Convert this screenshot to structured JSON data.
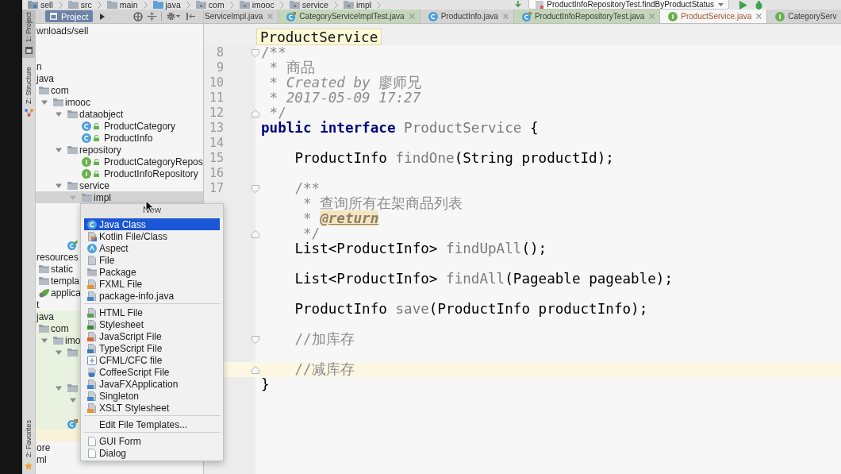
{
  "nav_bar": {
    "crumbs": [
      {
        "label": "sell",
        "kind": "module"
      },
      {
        "label": "src",
        "kind": "folder"
      },
      {
        "label": "main",
        "kind": "folder"
      },
      {
        "label": "java",
        "kind": "source"
      },
      {
        "label": "com",
        "kind": "package"
      },
      {
        "label": "imooc",
        "kind": "package"
      },
      {
        "label": "service",
        "kind": "package"
      },
      {
        "label": "impl",
        "kind": "package"
      }
    ],
    "run_config": "ProductInfoRepositoryTest.findByProductStatus"
  },
  "tool_strip": {
    "top": [
      {
        "label": "1: Project",
        "kind": "project",
        "selected": true
      },
      {
        "label": "Z: Structure",
        "kind": "structure",
        "selected": false
      }
    ],
    "bottom": [
      {
        "label": "2: Favorites",
        "kind": "favorites",
        "selected": false
      }
    ]
  },
  "project_panel": {
    "title": "Project",
    "nodes": [
      {
        "label": "wnloads/sell",
        "selected": false,
        "children": [
          {
            "selected": false
          },
          {
            "selected": false,
            "children": [
              {
                "label": "n",
                "selected": false,
                "children": [
                  {
                    "label": "java",
                    "selected": false,
                    "children": [
                      {
                        "label": "com",
                        "kind": "folder",
                        "selected": false,
                        "children": [
                          {
                            "label": "imooc",
                            "kind": "folder",
                            "expanded": true,
                            "selected": false,
                            "children": [
                              {
                                "label": "dataobject",
                                "kind": "folder",
                                "expanded": true,
                                "selected": false,
                                "children": [
                                  {
                                    "label": "ProductCategory",
                                    "kind": "class",
                                    "selected": false
                                  },
                                  {
                                    "label": "ProductInfo",
                                    "kind": "class",
                                    "selected": false
                                  }
                                ]
                              },
                              {
                                "label": "repository",
                                "kind": "folder",
                                "expanded": true,
                                "selected": false,
                                "children": [
                                  {
                                    "label": "ProductCategoryRepos",
                                    "kind": "interface",
                                    "selected": false
                                  },
                                  {
                                    "label": "ProductInfoRepository",
                                    "kind": "interface",
                                    "selected": false
                                  }
                                ]
                              },
                              {
                                "label": "service",
                                "kind": "folder",
                                "expanded": true,
                                "selected": false,
                                "children": [
                                  {
                                    "label": "impl",
                                    "kind": "folder",
                                    "expanded": true,
                                    "selected": true,
                                    "children": [
                                      {
                                        "selected": false
                                      },
                                      {
                                        "selected": false
                                      },
                                      {
                                        "selected": false
                                      }
                                    ]
                                  }
                                ]
                              },
                              {
                                "kind": "spring-class",
                                "selected": false
                              }
                            ]
                          }
                        ]
                      }
                    ]
                  },
                  {
                    "label": "resources",
                    "selected": false,
                    "children": [
                      {
                        "label": "static",
                        "kind": "folder",
                        "selected": false
                      },
                      {
                        "label": "templa",
                        "kind": "folder",
                        "selected": false
                      },
                      {
                        "label": "applica",
                        "kind": "spring-config",
                        "selected": false
                      }
                    ]
                  }
                ]
              },
              {
                "label": "t",
                "selected": false,
                "children": [
                  {
                    "label": "java",
                    "test_source": true,
                    "selected": false,
                    "children": [
                      {
                        "label": "com",
                        "kind": "folder",
                        "selected": false,
                        "children": [
                          {
                            "label": "imo",
                            "kind": "folder",
                            "expanded": true,
                            "selected": false,
                            "children": [
                              {
                                "kind": "folder",
                                "expanded": true,
                                "selected": false,
                                "children": [
                                  {
                                    "selected": false
                                  },
                                  {
                                    "selected": false
                                  }
                                ]
                              },
                              {
                                "kind": "folder",
                                "expanded": true,
                                "selected": false,
                                "children": [
                                  {
                                    "expanded": true,
                                    "selected": false,
                                    "children": [
                                      {
                                        "selected": false
                                      }
                                    ]
                                  }
                                ]
                              },
                              {
                                "kind": "test-class",
                                "selected": false
                              }
                            ]
                          }
                        ]
                      }
                    ]
                  }
                ]
              }
            ]
          },
          {
            "excluded": true,
            "selected": false
          },
          {
            "label": "ore",
            "selected": false
          },
          {
            "label": "ml",
            "selected": false
          }
        ]
      }
    ]
  },
  "editor": {
    "tabs": [
      {
        "label": "ServiceImpl.java",
        "kind": "none",
        "test": false,
        "unversioned": false,
        "selected": false
      },
      {
        "label": "CategoryServiceImplTest.java",
        "kind": "test-class",
        "test": true,
        "unversioned": false,
        "selected": false
      },
      {
        "label": "ProductInfo.java",
        "kind": "class",
        "test": false,
        "unversioned": false,
        "selected": false
      },
      {
        "label": "ProductInfoRepositoryTest.java",
        "kind": "test-class",
        "test": true,
        "unversioned": false,
        "selected": false
      },
      {
        "label": "ProductService.java",
        "kind": "interface",
        "test": false,
        "unversioned": true,
        "selected": true
      },
      {
        "label": "CategoryServ",
        "kind": "interface",
        "test": false,
        "unversioned": false,
        "selected": false
      }
    ],
    "breadcrumb": "ProductService",
    "lines": [
      {
        "number": "8",
        "fold_start": true,
        "current": false,
        "tokens": [
          {
            "text": "/**",
            "kind": "comment"
          }
        ]
      },
      {
        "number": "9",
        "current": false,
        "tokens": [
          {
            "text": " * 商品",
            "kind": "comment"
          }
        ]
      },
      {
        "number": "10",
        "current": false,
        "tokens": [
          {
            "text": " * ",
            "kind": "comment"
          },
          {
            "text": "Created by",
            "kind": "doc"
          },
          {
            "text": " 廖师兄",
            "kind": "comment"
          }
        ]
      },
      {
        "number": "11",
        "current": false,
        "tokens": [
          {
            "text": " * ",
            "kind": "comment"
          },
          {
            "text": "2017-05-09 17:27",
            "kind": "doc"
          }
        ]
      },
      {
        "number": "12",
        "fold_end": true,
        "current": false,
        "tokens": [
          {
            "text": " */",
            "kind": "comment"
          }
        ]
      },
      {
        "number": "13",
        "current": false,
        "tokens": [
          {
            "text": "public interface",
            "kind": "keyword"
          },
          {
            "text": " ProductService",
            "kind": "decl"
          },
          {
            "text": " {",
            "kind": "plain"
          }
        ]
      },
      {
        "number": "14",
        "current": false
      },
      {
        "number": "15",
        "current": false,
        "tokens": [
          {
            "text": "    ProductInfo ",
            "kind": "plain"
          },
          {
            "text": "findOne",
            "kind": "decl"
          },
          {
            "text": "(String productId);",
            "kind": "plain"
          }
        ]
      },
      {
        "number": "16",
        "current": false
      },
      {
        "number": "17",
        "fold_start": true,
        "current": false,
        "tokens": [
          {
            "text": "    /**",
            "kind": "comment"
          }
        ]
      },
      {
        "current": false,
        "tokens": [
          {
            "text": "     * 查询所有在架商品列表",
            "kind": "comment"
          }
        ]
      },
      {
        "current": false,
        "tokens": [
          {
            "text": "     * ",
            "kind": "comment"
          },
          {
            "text": "@return",
            "kind": "tag"
          }
        ]
      },
      {
        "fold_end": true,
        "current": false,
        "tokens": [
          {
            "text": "     */",
            "kind": "comment"
          }
        ]
      },
      {
        "current": false,
        "tokens": [
          {
            "text": "    List<ProductInfo> ",
            "kind": "plain"
          },
          {
            "text": "findUpAll",
            "kind": "decl"
          },
          {
            "text": "();",
            "kind": "plain"
          }
        ]
      },
      {
        "current": false
      },
      {
        "current": false,
        "tokens": [
          {
            "text": "    List<ProductInfo> ",
            "kind": "plain"
          },
          {
            "text": "findAll",
            "kind": "decl"
          },
          {
            "text": "(Pageable pageable);",
            "kind": "plain"
          }
        ]
      },
      {
        "current": false
      },
      {
        "current": false,
        "tokens": [
          {
            "text": "    ProductInfo ",
            "kind": "plain"
          },
          {
            "text": "save",
            "kind": "decl"
          },
          {
            "text": "(ProductInfo productInfo);",
            "kind": "plain"
          }
        ]
      },
      {
        "current": false
      },
      {
        "fold_start": true,
        "current": false,
        "tokens": [
          {
            "text": "    //加库存",
            "kind": "comment"
          }
        ]
      },
      {
        "current": false
      },
      {
        "fold_end": true,
        "current": true,
        "tokens": [
          {
            "text": "    //减库存",
            "kind": "comment"
          }
        ]
      },
      {
        "current": false,
        "tokens": [
          {
            "text": "}",
            "kind": "plain"
          }
        ]
      }
    ]
  },
  "context_menu": {
    "title": "New",
    "groups": [
      [
        {
          "label": "Java Class",
          "kind": "class",
          "selected": true
        },
        {
          "label": "Kotlin File/Class",
          "kind": "kotlin",
          "selected": false
        },
        {
          "label": "Aspect",
          "kind": "aspect",
          "selected": false
        },
        {
          "label": "File",
          "kind": "file",
          "selected": false
        },
        {
          "label": "Package",
          "kind": "package",
          "selected": false
        },
        {
          "label": "FXML File",
          "kind": "fxml",
          "selected": false
        },
        {
          "label": "package-info.java",
          "kind": "java-file",
          "selected": false
        }
      ],
      [
        {
          "label": "HTML File",
          "kind": "html",
          "selected": false
        },
        {
          "label": "Stylesheet",
          "kind": "css",
          "selected": false
        },
        {
          "label": "JavaScript File",
          "kind": "js",
          "selected": false
        },
        {
          "label": "TypeScript File",
          "kind": "ts",
          "selected": false
        },
        {
          "label": "CFML/CFC file",
          "kind": "cfml",
          "selected": false
        },
        {
          "label": "CoffeeScript File",
          "kind": "coffee",
          "selected": false
        },
        {
          "label": "JavaFXApplication",
          "kind": "javafx",
          "selected": false
        },
        {
          "label": "Singleton",
          "kind": "singleton",
          "selected": false
        },
        {
          "label": "XSLT Stylesheet",
          "kind": "xslt",
          "selected": false
        }
      ],
      [
        {
          "label": "Edit File Templates...",
          "kind": "none",
          "selected": false
        }
      ],
      [
        {
          "label": "GUI Form",
          "kind": "form",
          "selected": false
        },
        {
          "label": "Dialog",
          "kind": "form",
          "selected": false
        }
      ]
    ]
  }
}
